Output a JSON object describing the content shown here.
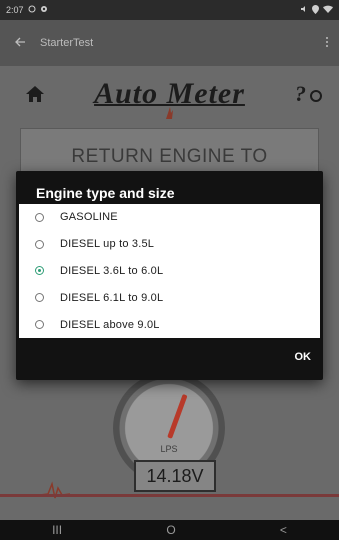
{
  "status_bar": {
    "time": "2:07",
    "left_icons": [
      "circle-icon",
      "settings-icon"
    ],
    "right_icons": [
      "mute-icon",
      "location-icon",
      "wifi-icon"
    ]
  },
  "app_bar": {
    "back_icon": "arrow-left-icon",
    "title": "StarterTest",
    "menu_icon": "vertical-dots-icon"
  },
  "header": {
    "logo": "Auto Meter",
    "home_icon": "home-icon",
    "help_icon": "help-icon"
  },
  "banner": {
    "text": "RETURN ENGINE TO"
  },
  "gauge": {
    "unit_label": "LPS"
  },
  "voltage": {
    "value": "14.18V"
  },
  "dialog": {
    "title": "Engine type and size",
    "options": [
      {
        "label": "GASOLINE",
        "selected": false
      },
      {
        "label": "DIESEL up to 3.5L",
        "selected": false
      },
      {
        "label": "DIESEL 3.6L to 6.0L",
        "selected": true
      },
      {
        "label": "DIESEL 6.1L to 9.0L",
        "selected": false
      },
      {
        "label": "DIESEL above 9.0L",
        "selected": false
      }
    ],
    "ok_label": "OK"
  },
  "nav_bar": {
    "recents": "III",
    "home": "O",
    "back": "<"
  },
  "colors": {
    "accent": "#2e9d76",
    "dialog_bg": "#121212",
    "app_bg": "#6a6a6a"
  }
}
